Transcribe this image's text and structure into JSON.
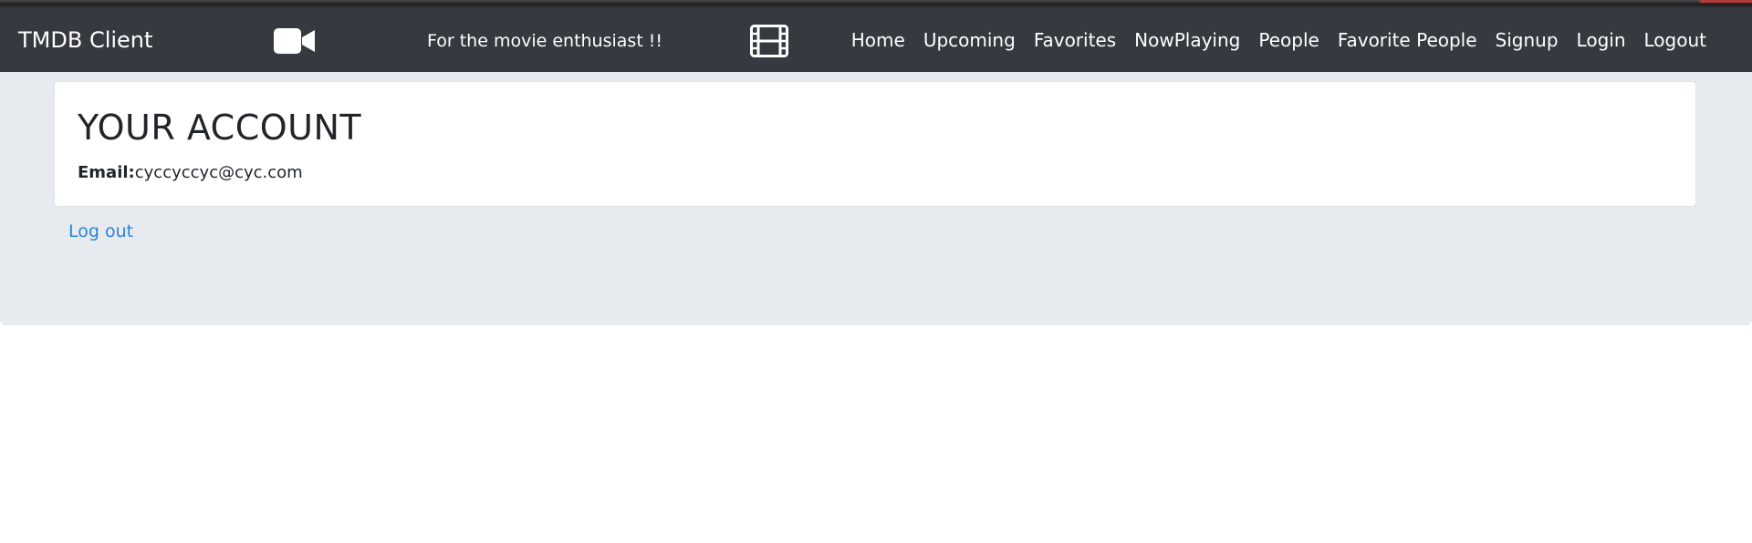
{
  "navbar": {
    "brand": "TMDB Client",
    "tagline": "For the movie enthusiast !!",
    "camera_icon": "video-camera-icon",
    "film_icon": "film-strip-icon",
    "links": [
      "Home",
      "Upcoming",
      "Favorites",
      "NowPlaying",
      "People",
      "Favorite People",
      "Signup",
      "Login",
      "Logout"
    ],
    "background_color": "#343a40"
  },
  "account": {
    "title": "YOUR ACCOUNT",
    "email_label": "Email:",
    "email_value": "cyccyccyc@cyc.com"
  },
  "actions": {
    "logout_label": "Log out"
  },
  "colors": {
    "link": "#2c83d6",
    "panel_background": "#e7ebef"
  }
}
